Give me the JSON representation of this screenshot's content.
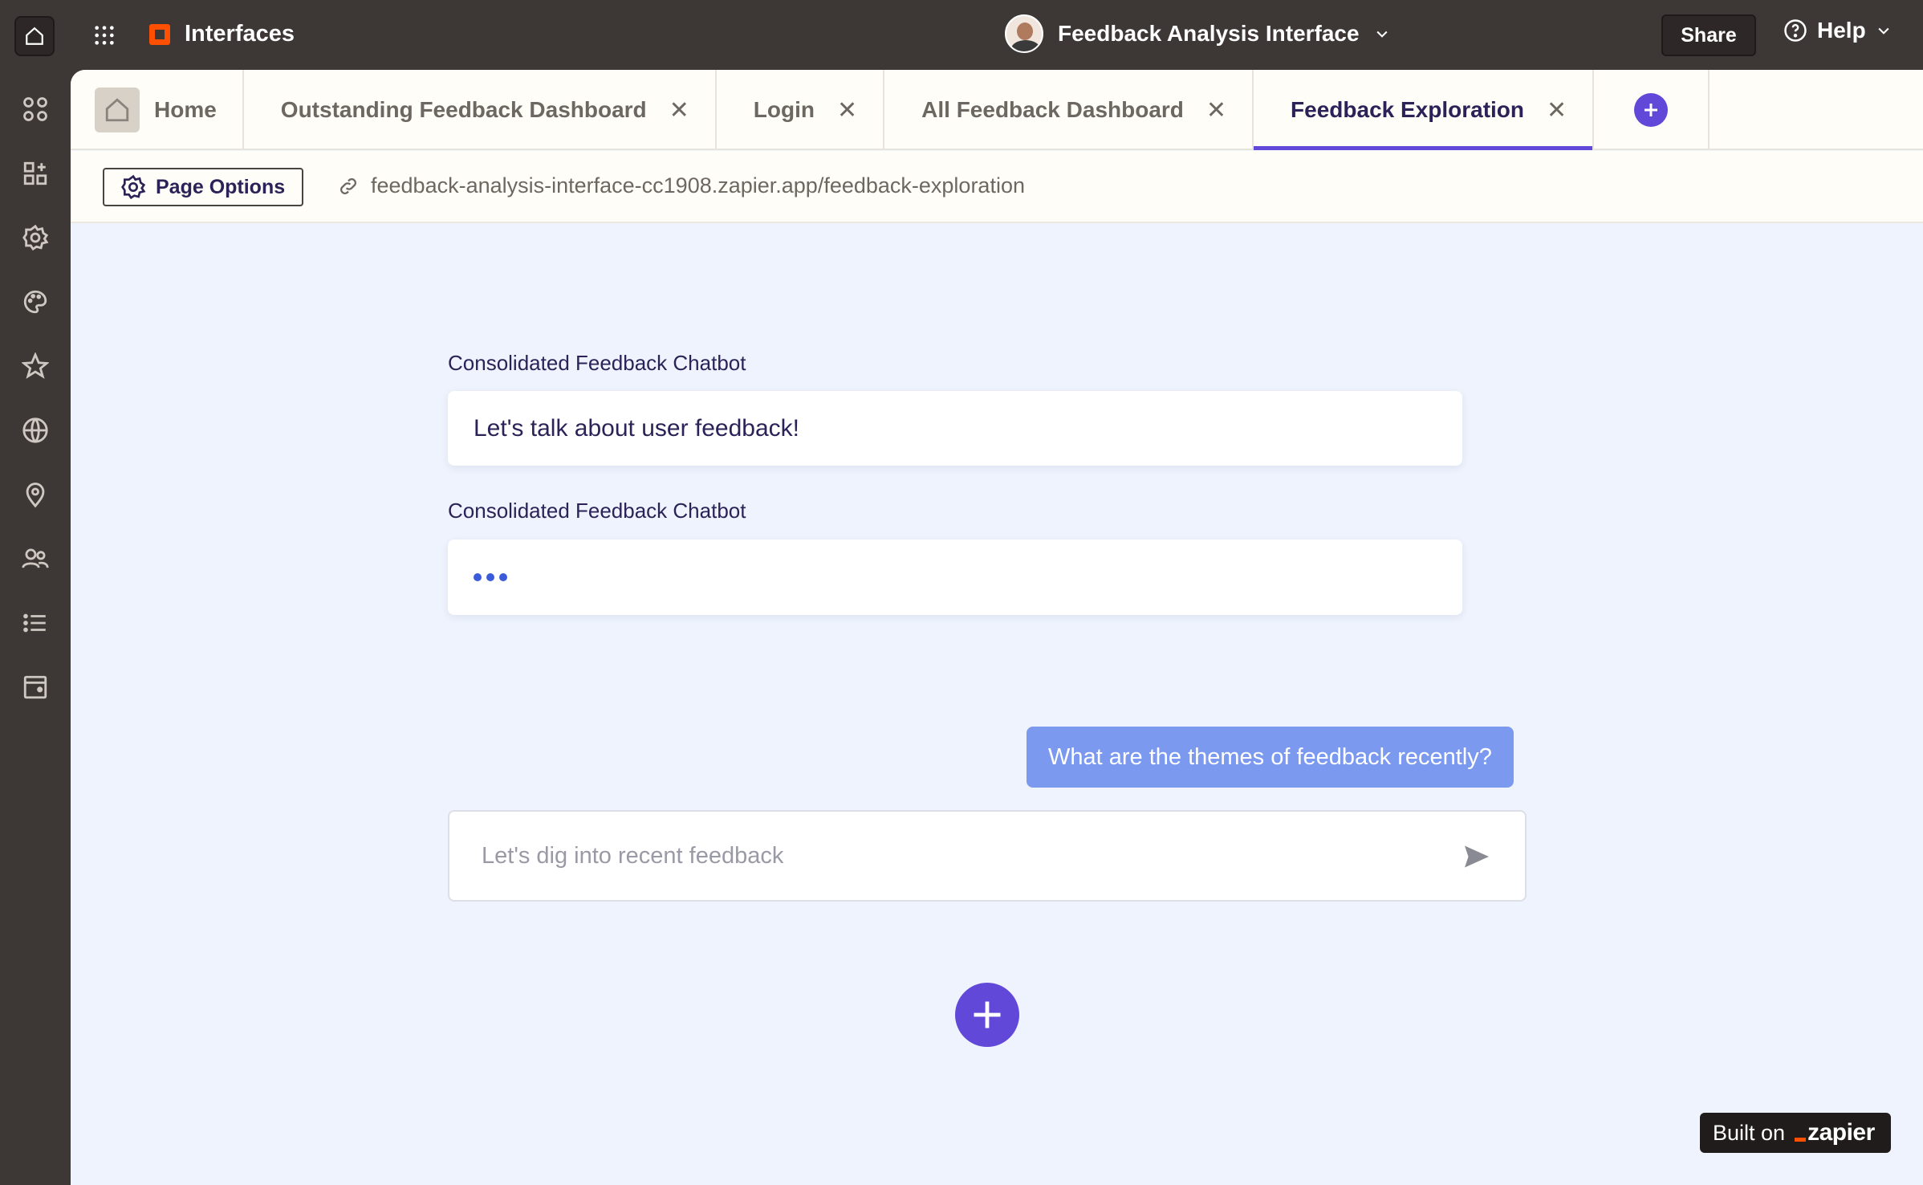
{
  "topbar": {
    "brand": "Interfaces",
    "project": "Feedback Analysis Interface",
    "share": "Share",
    "help": "Help"
  },
  "tabs": [
    {
      "label": "Home"
    },
    {
      "label": "Outstanding Feedback Dashboard"
    },
    {
      "label": "Login"
    },
    {
      "label": "All Feedback Dashboard"
    },
    {
      "label": "Feedback Exploration",
      "active": true
    }
  ],
  "urlbar": {
    "page_options": "Page Options",
    "url": "feedback-analysis-interface-cc1908.zapier.app/feedback-exploration"
  },
  "chat": {
    "bot_label_1": "Consolidated Feedback Chatbot",
    "bot_message_1": "Let's talk about user feedback!",
    "bot_label_2": "Consolidated Feedback Chatbot",
    "user_message": "What are the themes of feedback recently?",
    "input_placeholder": "Let's dig into recent feedback"
  },
  "badge": {
    "built_on": "Built on",
    "brand": "zapier"
  },
  "colors": {
    "accent": "#6148d8",
    "user_bubble": "#7b99ef",
    "topbar": "#3d3735",
    "main_bg": "#eef3fd"
  },
  "icons": {
    "rail": [
      "apps-grid-icon",
      "add-widget-icon",
      "settings-icon",
      "palette-icon",
      "star-icon",
      "globe-icon",
      "location-pin-icon",
      "users-icon",
      "list-icon",
      "browser-window-icon"
    ]
  }
}
